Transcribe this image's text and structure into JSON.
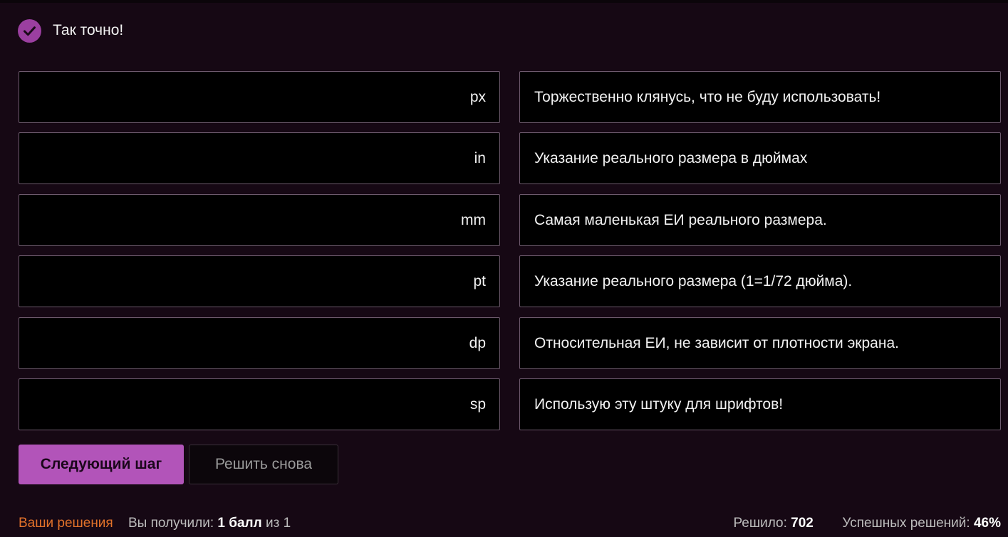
{
  "feedback": {
    "message": "Так точно!",
    "icon": "check-icon",
    "accent": "#9b3fa0"
  },
  "matching": {
    "terms": [
      "px",
      "in",
      "mm",
      "pt",
      "dp",
      "sp"
    ],
    "definitions": [
      "Торжественно клянусь, что не буду использовать!",
      "Указание реального размера в дюймах",
      "Самая маленькая ЕИ реального размера.",
      "Указание реального размера (1=1/72 дюйма).",
      "Относительная ЕИ, не зависит от плотности экрана.",
      "Использую эту штуку для шрифтов!"
    ]
  },
  "actions": {
    "next_label": "Следующий шаг",
    "retry_label": "Решить снова"
  },
  "footer": {
    "solutions_link": "Ваши решения",
    "received_prefix": "Вы получили:",
    "score": "1 балл",
    "score_suffix": "из 1",
    "solved_label": "Решило:",
    "solved_count": "702",
    "success_label": "Успешных решений:",
    "success_rate": "46%"
  },
  "colors": {
    "background": "#160814",
    "box_background": "#000000",
    "box_border": "#6d5a6d",
    "primary_button": "#b254b9",
    "link": "#e2722a"
  }
}
